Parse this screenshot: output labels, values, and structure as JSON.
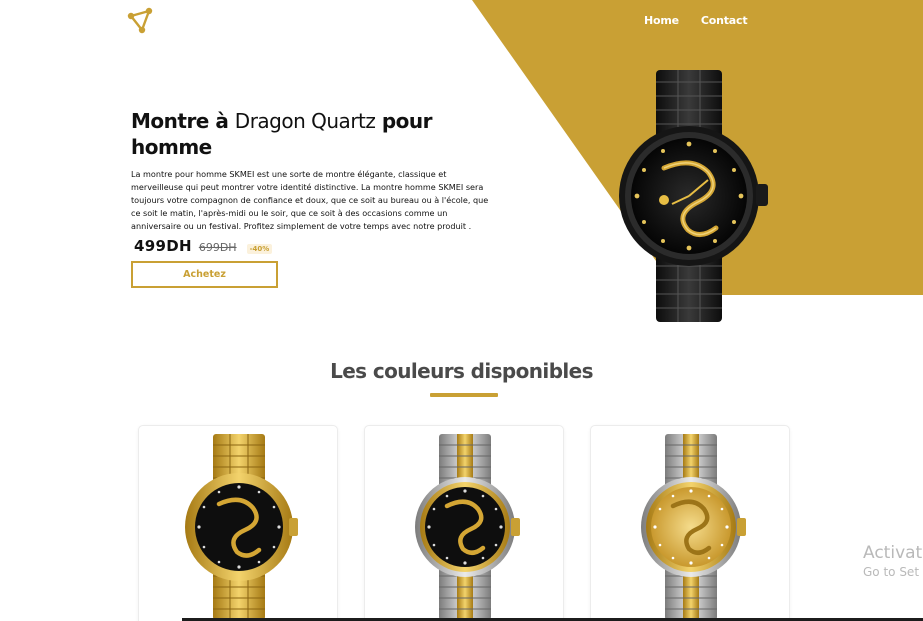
{
  "nav": {
    "links": [
      "Home",
      "Contact"
    ]
  },
  "hero": {
    "title_part1": "Montre à ",
    "title_part2": "Dragon Quartz",
    "title_part3": " pour homme",
    "description": "La montre pour homme SKMEI est une sorte de montre élégante, classique et merveilleuse qui peut montrer votre identité distinctive. La montre homme SKMEI sera toujours votre compagnon de confiance et doux, que ce soit au bureau ou à l'école, que ce soit le matin, l'après-midi ou le soir, que ce soit à des occasions comme un anniversaire ou un festival. Profitez simplement de votre temps avec notre produit .",
    "price": "499DH",
    "old_price": "699DH",
    "discount": "-40%",
    "buy_label": "Achetez"
  },
  "colors_section": {
    "title": "Les couleurs disponibles",
    "cards": [
      {
        "variant": "gold-black"
      },
      {
        "variant": "silver-gold-black"
      },
      {
        "variant": "silver-gold-gold"
      }
    ]
  },
  "watermark": {
    "line1": "Activat",
    "line2": "Go to Set"
  },
  "theme": {
    "accent": "#c9a034",
    "dark": "#111111",
    "text_muted": "#4a4a4a"
  }
}
